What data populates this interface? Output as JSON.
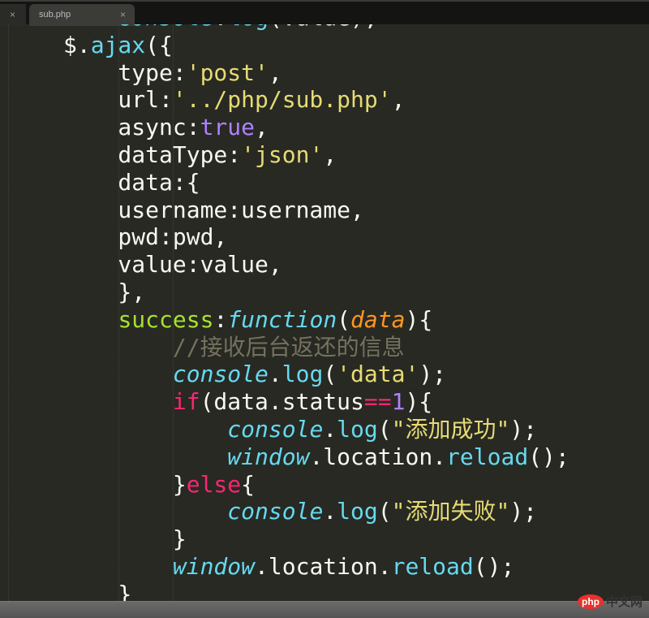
{
  "tabs": [
    {
      "label": "",
      "close": "×"
    },
    {
      "label": "sub.php",
      "close": "×"
    }
  ],
  "watermark": {
    "logo": "php",
    "text": "中文网"
  },
  "code": [
    [
      [
        "    ",
        "w"
      ],
      [
        "console",
        "ci"
      ],
      [
        ".",
        "w"
      ],
      [
        "log",
        "c"
      ],
      [
        "(value);",
        "w"
      ]
    ],
    [
      [
        "$.",
        "w"
      ],
      [
        "ajax",
        "c"
      ],
      [
        "({",
        "w"
      ]
    ],
    [
      [
        "    type:",
        "w"
      ],
      [
        "'post'",
        "s"
      ],
      [
        ",",
        "w"
      ]
    ],
    [
      [
        "    url:",
        "w"
      ],
      [
        "'../php/sub.php'",
        "s"
      ],
      [
        ",",
        "w"
      ]
    ],
    [
      [
        "    async:",
        "w"
      ],
      [
        "true",
        "p"
      ],
      [
        ",",
        "w"
      ]
    ],
    [
      [
        "    dataType:",
        "w"
      ],
      [
        "'json'",
        "s"
      ],
      [
        ",",
        "w"
      ]
    ],
    [
      [
        "    data:{",
        "w"
      ]
    ],
    [
      [
        "    username:username,",
        "w"
      ]
    ],
    [
      [
        "    pwd:pwd,",
        "w"
      ]
    ],
    [
      [
        "    value:value,",
        "w"
      ]
    ],
    [
      [
        "    },",
        "w"
      ]
    ],
    [
      [
        "    ",
        "w"
      ],
      [
        "success",
        "g"
      ],
      [
        ":",
        "w"
      ],
      [
        "function",
        "ci"
      ],
      [
        "(",
        "w"
      ],
      [
        "data",
        "o"
      ],
      [
        "){",
        "w"
      ]
    ],
    [
      [
        "        ",
        "w"
      ],
      [
        "//接收后台返还的信息",
        "m"
      ]
    ],
    [
      [
        "        ",
        "w"
      ],
      [
        "console",
        "ci"
      ],
      [
        ".",
        "w"
      ],
      [
        "log",
        "c"
      ],
      [
        "(",
        "w"
      ],
      [
        "'data'",
        "s"
      ],
      [
        ");",
        "w"
      ]
    ],
    [
      [
        "        ",
        "w"
      ],
      [
        "if",
        "k"
      ],
      [
        "(data.status",
        "w"
      ],
      [
        "==",
        "k"
      ],
      [
        "1",
        "p"
      ],
      [
        "){",
        "w"
      ]
    ],
    [
      [
        "            ",
        "w"
      ],
      [
        "console",
        "ci"
      ],
      [
        ".",
        "w"
      ],
      [
        "log",
        "c"
      ],
      [
        "(",
        "w"
      ],
      [
        "\"添加成功\"",
        "s"
      ],
      [
        ");",
        "w"
      ]
    ],
    [
      [
        "            ",
        "w"
      ],
      [
        "window",
        "ci"
      ],
      [
        ".location.",
        "w"
      ],
      [
        "reload",
        "c"
      ],
      [
        "();",
        "w"
      ]
    ],
    [
      [
        "        }",
        "w"
      ],
      [
        "else",
        "k"
      ],
      [
        "{",
        "w"
      ]
    ],
    [
      [
        "            ",
        "w"
      ],
      [
        "console",
        "ci"
      ],
      [
        ".",
        "w"
      ],
      [
        "log",
        "c"
      ],
      [
        "(",
        "w"
      ],
      [
        "\"添加失败\"",
        "s"
      ],
      [
        ");",
        "w"
      ]
    ],
    [
      [
        "        }",
        "w"
      ]
    ],
    [
      [
        "        ",
        "w"
      ],
      [
        "window",
        "ci"
      ],
      [
        ".location.",
        "w"
      ],
      [
        "reload",
        "c"
      ],
      [
        "();",
        "w"
      ]
    ],
    [
      [
        "    }",
        "w"
      ]
    ]
  ]
}
